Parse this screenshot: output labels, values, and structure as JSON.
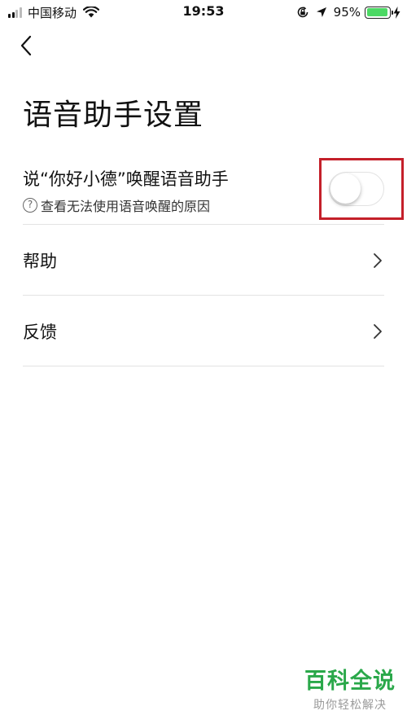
{
  "status_bar": {
    "carrier": "中国移动",
    "time": "19:53",
    "battery_percent": "95%",
    "battery_level": 0.95,
    "signal_bars_filled": 2,
    "icons": [
      "signal-icon",
      "wifi-icon",
      "orientation-lock-icon",
      "location-arrow-icon",
      "battery-icon",
      "charging-icon"
    ]
  },
  "header": {
    "back_icon": "chevron-left-icon"
  },
  "page": {
    "title": "语音助手设置"
  },
  "voice_wake": {
    "label": "说“你好小德”唤醒语音助手",
    "help_icon_glyph": "?",
    "help_text": "查看无法使用语音唤醒的原因",
    "toggle_on": false,
    "highlight_color": "#c4202a"
  },
  "menu": {
    "items": [
      {
        "label": "帮助",
        "icon": "chevron-right-icon"
      },
      {
        "label": "反馈",
        "icon": "chevron-right-icon"
      }
    ]
  },
  "watermark": {
    "title": "百科全说",
    "subtitle": "助你轻松解决",
    "color": "#2aa84a"
  }
}
